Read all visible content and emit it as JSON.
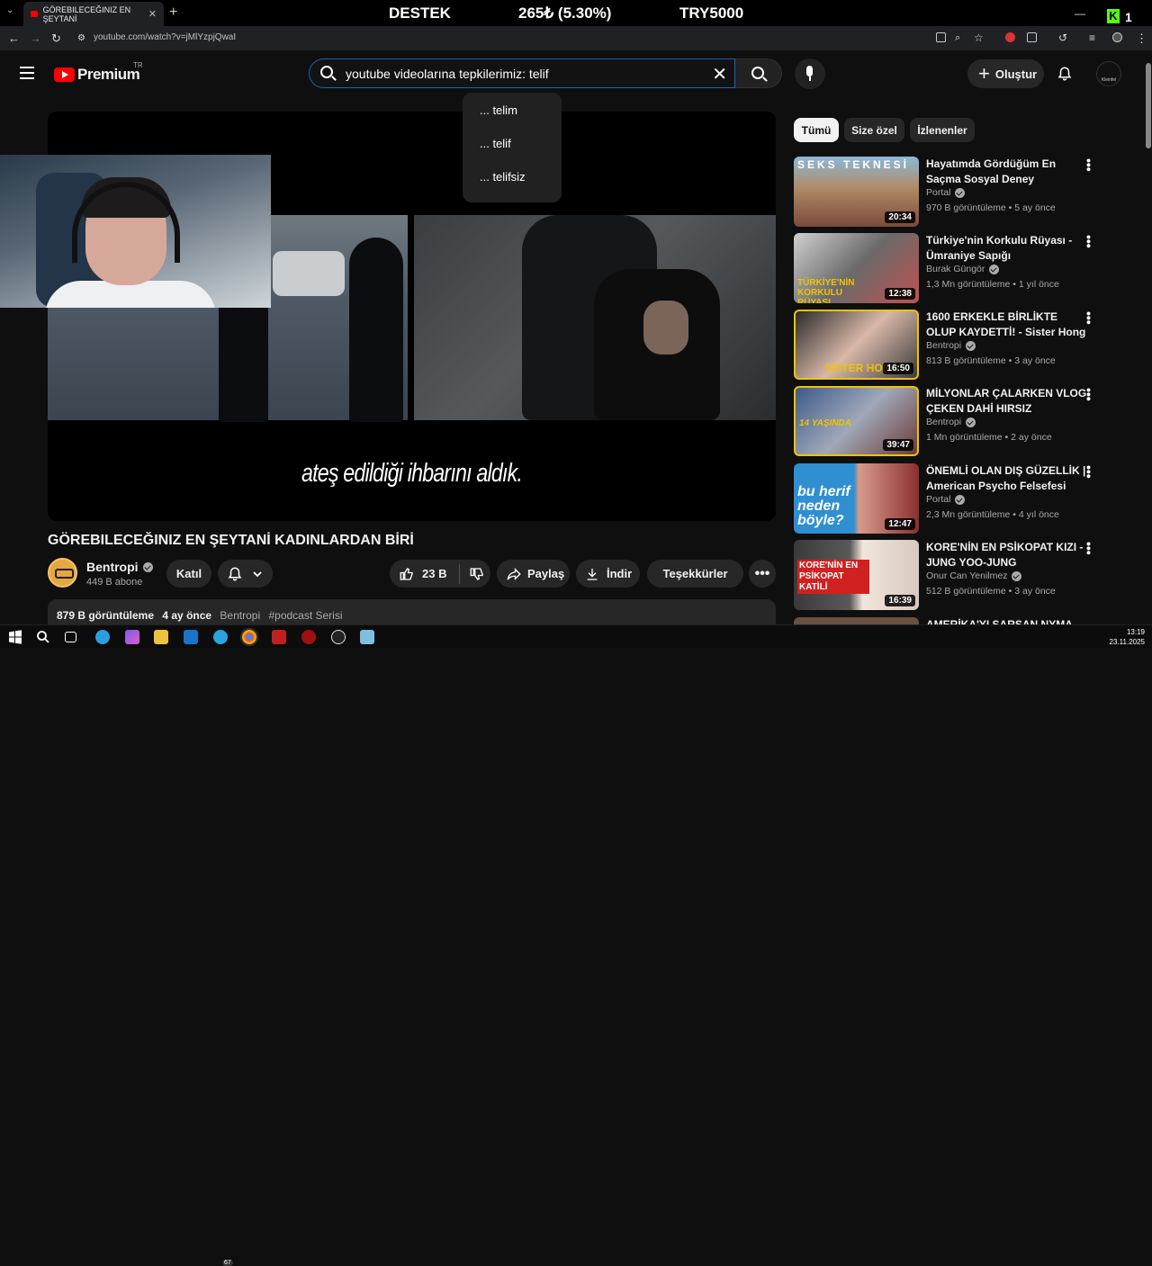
{
  "browser": {
    "tab_title": "GÖREBILECEĞINIZ EN ŞEYTANİ",
    "url": "youtube.com/watch?v=jMlYzpjQwaI"
  },
  "stream_banner": {
    "left": "DESTEK",
    "center": "265₺ (5.30%)",
    "right": "TRY5000",
    "kick_badge": "1"
  },
  "header": {
    "logo_text": "Premium",
    "region": "TR",
    "search_query": "youtube videolarına tepkilerimiz: telif",
    "create_label": "Oluştur",
    "avatar_text": "Kleinfel"
  },
  "suggestions": [
    "... telim",
    "... telif",
    "... telifsiz"
  ],
  "player": {
    "subtitle": "ateş edildiği ihbarını aldık."
  },
  "video": {
    "title": "GÖREBILECEĞINIZ EN ŞEYTANİ KADINLARDAN BİRİ",
    "channel": "Bentropi",
    "subscribers": "449 B abone",
    "join_label": "Katıl",
    "likes": "23 B",
    "share_label": "Paylaş",
    "download_label": "İndir",
    "thanks_label": "Teşekkürler",
    "views": "879 B görüntüleme",
    "age": "4 ay önce",
    "desc_channel": "Bentropi",
    "desc_tag": "#podcast Serisi"
  },
  "chips": [
    "Tümü",
    "Size özel",
    "İzlenenler"
  ],
  "recommendations": [
    {
      "title": "Hayatımda Gördüğüm En Saçma Sosyal Deney",
      "channel": "Portal",
      "meta": "970 B görüntüleme • 5 ay önce",
      "duration": "20:34",
      "thumb_text": "SEKS TEKNESİ"
    },
    {
      "title": "Türkiye'nin Korkulu Rüyası - Ümraniye Sapığı",
      "channel": "Burak Güngör",
      "meta": "1,3 Mn görüntüleme • 1 yıl önce",
      "duration": "12:38",
      "thumb_text": "TÜRKİYE'NİN KORKULU RÜYASI"
    },
    {
      "title": "1600 ERKEKLE BİRLİKTE OLUP KAYDETTİ! - Sister Hong",
      "channel": "Bentropi",
      "meta": "813 B görüntüleme • 3 ay önce",
      "duration": "16:50",
      "thumb_text": "SISTER HONG"
    },
    {
      "title": "MİLYONLAR ÇALARKEN VLOG ÇEKEN DAHİ HIRSIZ",
      "channel": "Bentropi",
      "meta": "1 Mn görüntüleme • 2 ay önce",
      "duration": "39:47",
      "thumb_text": "14 YAŞINDA"
    },
    {
      "title": "ÖNEMLİ OLAN DIŞ GÜZELLİK | American Psycho Felsefesi",
      "channel": "Portal",
      "meta": "2,3 Mn görüntüleme • 4 yıl önce",
      "duration": "12:47",
      "thumb_text": "bu herif neden böyle?"
    },
    {
      "title": "KORE'NİN EN PSİKOPAT KIZI - JUNG YOO-JUNG",
      "channel": "Onur Can Yenilmez",
      "meta": "512 B görüntüleme • 3 ay önce",
      "duration": "16:39",
      "thumb_text": "KORE'NİN EN PSİKOPAT KATİLİ"
    },
    {
      "title": "AMERİKA'YI SARSAN NYMA",
      "channel": "",
      "meta": "",
      "duration": "",
      "thumb_text": ""
    }
  ],
  "taskbar": {
    "telegram_badge": "67",
    "time": "13:19",
    "date": "23.11.2025"
  }
}
